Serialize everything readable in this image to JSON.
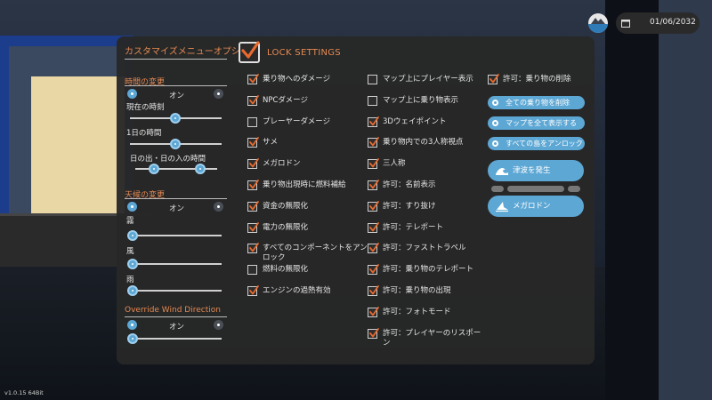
{
  "topbar": {
    "date": "01/06/2032"
  },
  "version": "v1.0.15 64Bit",
  "sidebar": {
    "title": "カスタマイズメニューオプション",
    "time": {
      "section_label": "時間の変更",
      "toggle_label": "オン",
      "current_time_label": "現在の時刻",
      "day_time_label": "1日の時間",
      "sunrise_sunset_label": "日の出・日の入の時間"
    },
    "weather": {
      "section_label": "天候の変更",
      "toggle_label": "オン",
      "fog_label": "霧",
      "wind_label": "風",
      "rain_label": "雨"
    },
    "wind_override": {
      "section_label": "Override Wind Direction",
      "toggle_label": "オン"
    }
  },
  "lock_settings": {
    "title": "LOCK SETTINGS",
    "checked": true
  },
  "column1": [
    {
      "label": "乗り物へのダメージ",
      "checked": true
    },
    {
      "label": "NPCダメージ",
      "checked": true
    },
    {
      "label": "プレーヤーダメージ",
      "checked": false
    },
    {
      "label": "サメ",
      "checked": true
    },
    {
      "label": "メガロドン",
      "checked": true
    },
    {
      "label": "乗り物出現時に燃料補給",
      "checked": true
    },
    {
      "label": "資金の無限化",
      "checked": true
    },
    {
      "label": "電力の無限化",
      "checked": true
    },
    {
      "label": "すべてのコンポーネントをアンロック",
      "checked": true
    },
    {
      "label": "燃料の無限化",
      "checked": false
    },
    {
      "label": "エンジンの過熱有効",
      "checked": true
    }
  ],
  "column2": [
    {
      "label": "マップ上にプレイヤー表示",
      "checked": false
    },
    {
      "label": "マップ上に乗り物表示",
      "checked": false
    },
    {
      "label": "3Dウェイポイント",
      "checked": true
    },
    {
      "label": "乗り物内での3人称視点",
      "checked": true
    },
    {
      "label": "三人称",
      "checked": true
    },
    {
      "label": "許可：名前表示",
      "checked": true
    },
    {
      "label": "許可：すり抜け",
      "checked": true
    },
    {
      "label": "許可：テレポート",
      "checked": true
    },
    {
      "label": "許可：ファストトラベル",
      "checked": true
    },
    {
      "label": "許可：乗り物のテレポート",
      "checked": true
    },
    {
      "label": "許可：乗り物の出現",
      "checked": true
    },
    {
      "label": "許可：フォトモード",
      "checked": true
    },
    {
      "label": "許可：プレイヤーのリスポーン",
      "checked": true
    }
  ],
  "column3": {
    "allow_delete_vehicle": {
      "label": "許可：乗り物の削除",
      "checked": true
    },
    "actions": [
      {
        "label": "全ての乗り物を削除"
      },
      {
        "label": "マップを全て表示する"
      },
      {
        "label": "すべての島をアンロック"
      }
    ],
    "tsunami_button": "津波を発生",
    "megalodon_button": "メガロドン"
  },
  "colors": {
    "accent": "#5da7d4",
    "heading": "#e58a52",
    "panel": "#282828"
  }
}
